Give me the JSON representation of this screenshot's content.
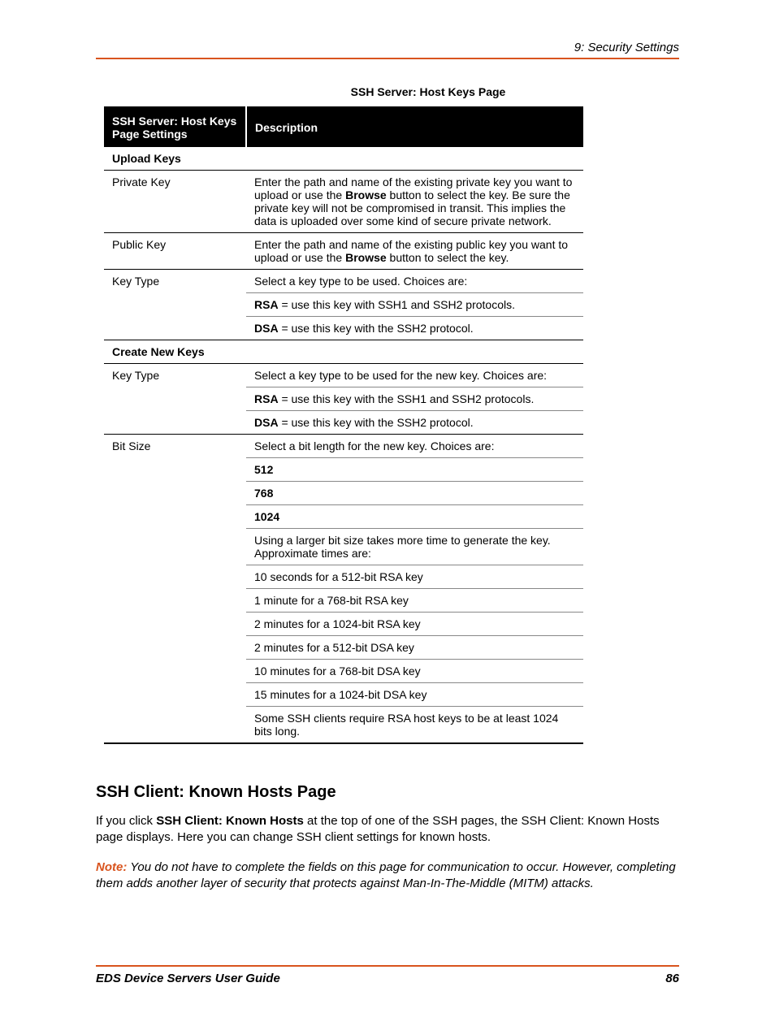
{
  "header": {
    "breadcrumb": "9: Security Settings"
  },
  "table": {
    "title": "SSH Server: Host Keys Page",
    "head_col1": "SSH Server: Host Keys Page Settings",
    "head_col2": "Description",
    "sections": {
      "upload_keys": "Upload Keys",
      "create_new_keys": "Create New Keys"
    },
    "rows": {
      "private_key_label": "Private Key",
      "private_key_desc_1": "Enter the path and name of the existing private key you want to upload or use the ",
      "private_key_desc_bold": "Browse",
      "private_key_desc_2": " button to select the key. Be sure the private key will not be compromised in transit. This implies the data is uploaded over some kind of secure private network.",
      "public_key_label": "Public Key",
      "public_key_desc_1": "Enter the path and name of the existing public key you want to upload or use the ",
      "public_key_desc_bold": "Browse",
      "public_key_desc_2": " button to select the key.",
      "key_type_label": "Key Type",
      "key_type_desc": "Select a key type to be used. Choices are:",
      "key_type_rsa_bold": "RSA",
      "key_type_rsa_text": " = use this key with SSH1 and SSH2 protocols.",
      "key_type_dsa_bold": "DSA",
      "key_type_dsa_text": " = use this key with the SSH2 protocol.",
      "key_type2_label": "Key Type",
      "key_type2_desc": "Select a key type to be used for the new key. Choices are:",
      "key_type2_rsa_bold": "RSA",
      "key_type2_rsa_text": " = use this key with the SSH1 and SSH2 protocols.",
      "key_type2_dsa_bold": "DSA",
      "key_type2_dsa_text": " = use this key with the SSH2 protocol.",
      "bit_size_label": "Bit Size",
      "bit_size_desc": "Select a bit length for the new key. Choices are:",
      "bit_512": "512",
      "bit_768": "768",
      "bit_1024": "1024",
      "bit_note": "Using a larger bit size takes more time to generate the key. Approximate times are:",
      "t1": "10 seconds for a 512-bit RSA key",
      "t2": "1 minute for a 768-bit RSA key",
      "t3": "2 minutes for a 1024-bit RSA key",
      "t4": "2 minutes for a 512-bit DSA key",
      "t5": "10 minutes for a 768-bit DSA key",
      "t6": "15 minutes for a 1024-bit DSA key",
      "bit_final": "Some SSH clients require RSA host keys to be at least 1024 bits long."
    }
  },
  "section": {
    "heading": "SSH Client: Known Hosts Page",
    "para_1a": "If you click ",
    "para_1b": "SSH Client: Known Hosts",
    "para_1c": " at the top of one of the SSH pages, the SSH Client: Known Hosts page displays. Here you can change SSH client settings for known hosts.",
    "note_label": "Note:",
    "note_text": " You do not have to complete the fields on this page for communication to occur. However, completing them adds another layer of security that protects against Man-In-The-Middle (MITM) attacks."
  },
  "footer": {
    "left": "EDS Device Servers User Guide",
    "right": "86"
  }
}
